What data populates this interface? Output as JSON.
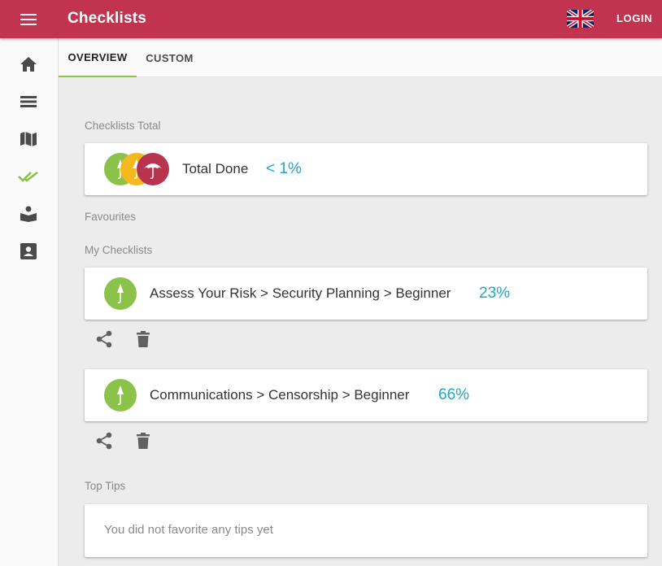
{
  "header": {
    "menu_icon": "hamburger-menu-icon",
    "title": "Checklists",
    "language_icon": "uk-flag-icon",
    "login_label": "LOGIN"
  },
  "sidebar": {
    "items": [
      {
        "icon": "home-icon",
        "active": false
      },
      {
        "icon": "list-view-icon",
        "active": false
      },
      {
        "icon": "map-icon",
        "active": false
      },
      {
        "icon": "double-check-icon",
        "active": true
      },
      {
        "icon": "reader-icon",
        "active": false
      },
      {
        "icon": "contact-card-icon",
        "active": false
      }
    ]
  },
  "tabs": [
    {
      "label": "OVERVIEW",
      "active": true
    },
    {
      "label": "CUSTOM",
      "active": false
    }
  ],
  "sections": {
    "total_label": "Checklists Total",
    "favourites_label": "Favourites",
    "my_checklists_label": "My Checklists",
    "top_tips_label": "Top Tips"
  },
  "total_card": {
    "label": "Total Done",
    "percent": "< 1%"
  },
  "checklists": [
    {
      "path": "Assess Your Risk > Security Planning > Beginner",
      "percent": "23%"
    },
    {
      "path": "Communications > Censorship > Beginner",
      "percent": "66%"
    }
  ],
  "tips": {
    "empty_text": "You did not favorite any tips yet"
  },
  "colors": {
    "brand": "#c2334f",
    "accent_green": "#8bc34a",
    "percent": "#1ba7c7",
    "badge_beginner": "#8bc34a",
    "badge_intermediate": "#f4b91e",
    "badge_advanced": "#b7344f"
  }
}
